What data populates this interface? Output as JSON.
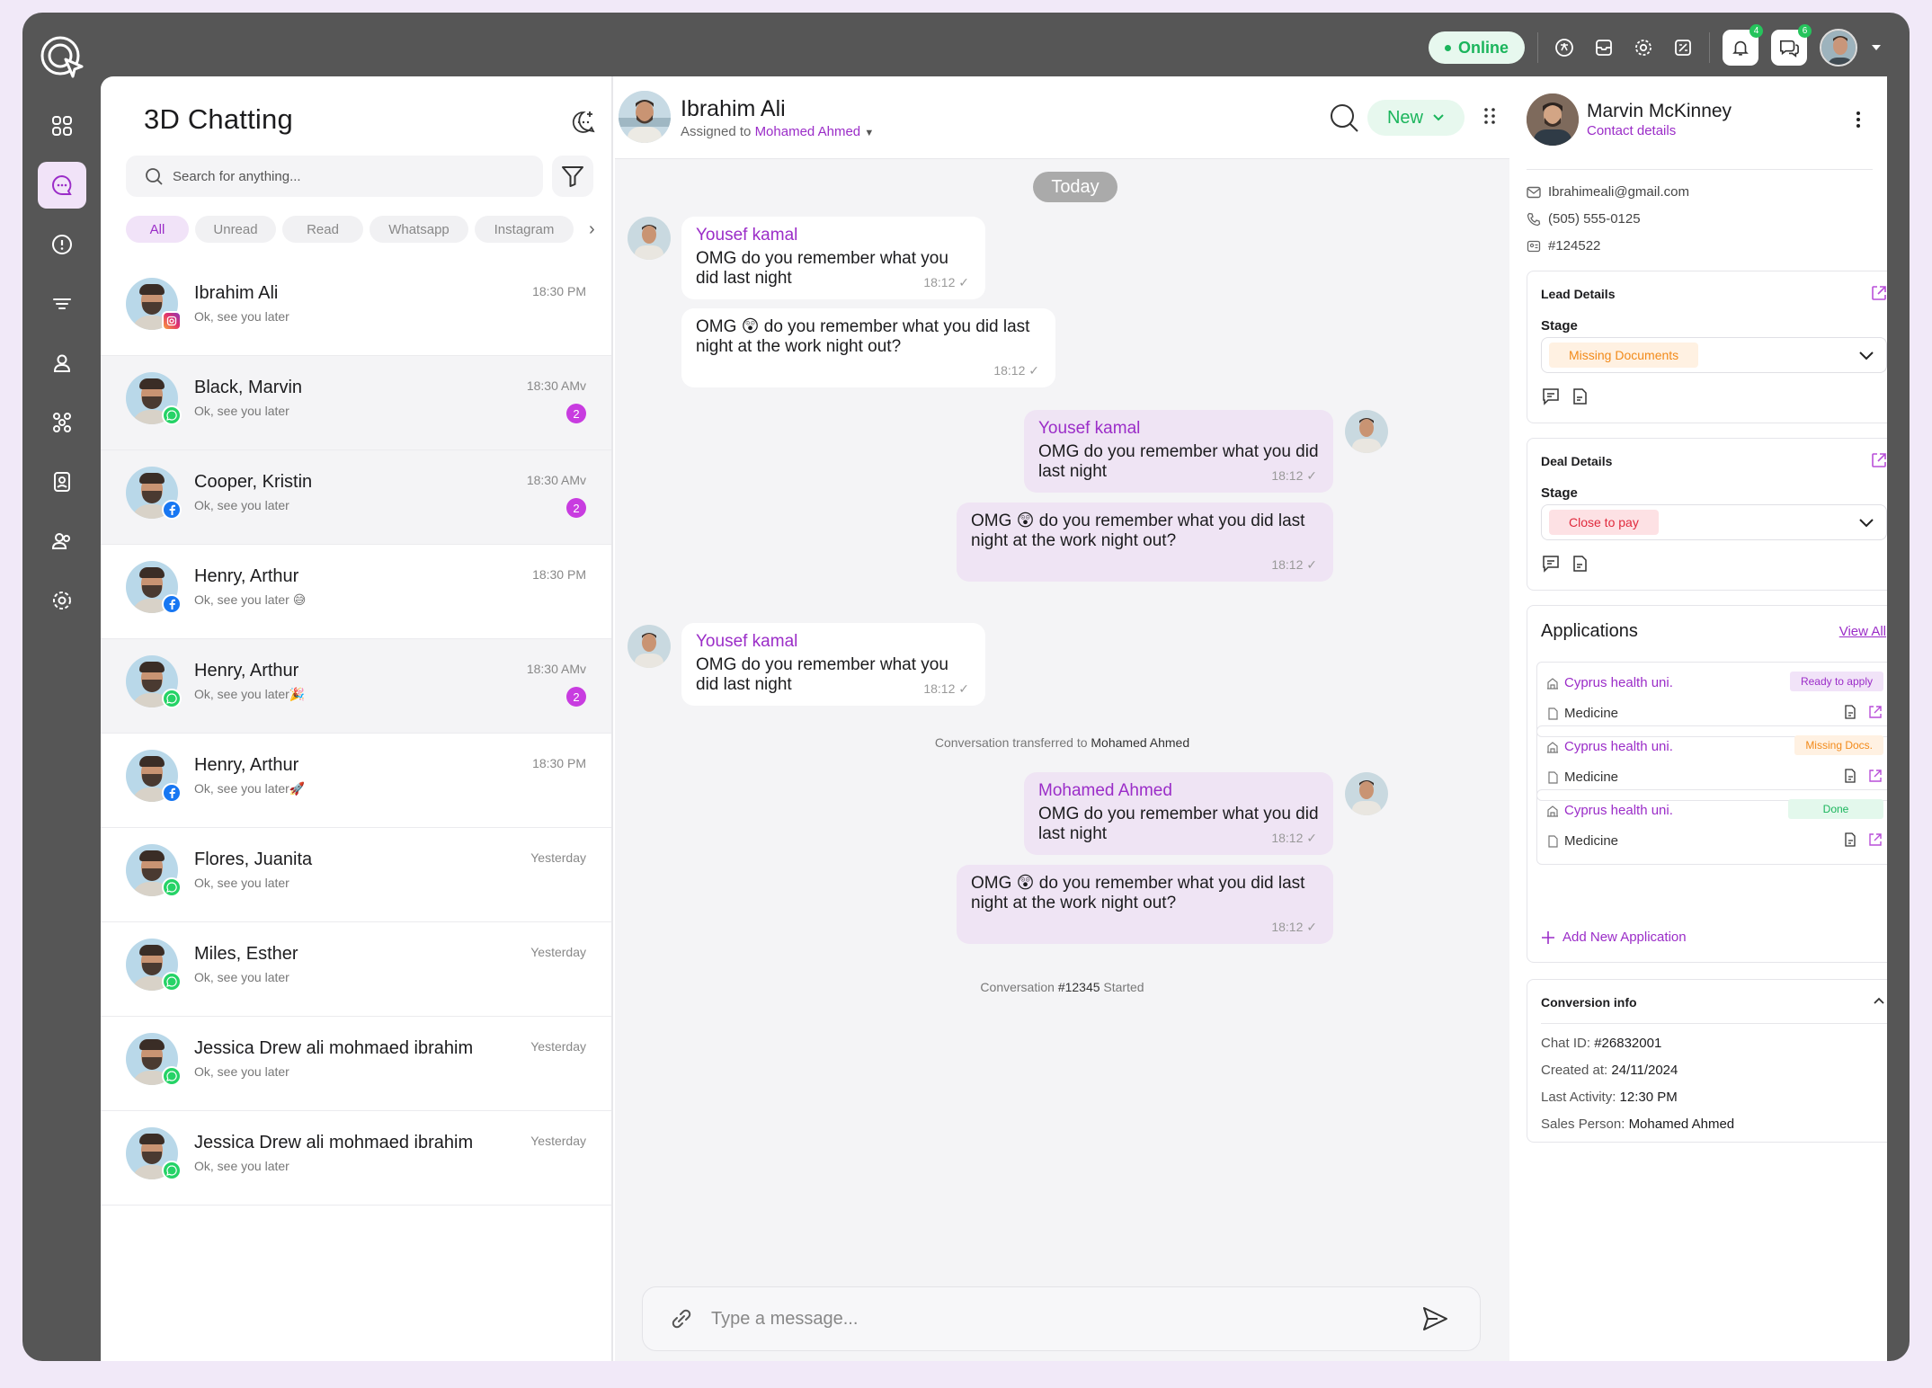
{
  "topbar": {
    "status": "Online",
    "notifications_count": "4",
    "messages_count": "6"
  },
  "sidenav": {
    "items": [
      "dashboard",
      "chat",
      "alerts",
      "filters",
      "contacts",
      "workflows",
      "reports",
      "team",
      "settings"
    ]
  },
  "list": {
    "title": "3D Chatting",
    "search_placeholder": "Search for anything...",
    "filters": [
      "All",
      "Unread",
      "Read",
      "Whatsapp",
      "Instagram"
    ],
    "conversations": [
      {
        "name": "Ibrahim Ali",
        "message": "Ok, see you later",
        "time": "18:30 PM",
        "channel": "instagram",
        "badge": ""
      },
      {
        "name": "Black, Marvin",
        "message": "Ok, see you later",
        "time": "18:30 AMv",
        "channel": "whatsapp",
        "badge": "2"
      },
      {
        "name": "Cooper, Kristin",
        "message": "Ok, see you later",
        "time": "18:30 AMv",
        "channel": "facebook",
        "badge": "2"
      },
      {
        "name": "Henry, Arthur",
        "message": "Ok, see you later 😅",
        "time": "18:30 PM",
        "channel": "facebook",
        "badge": ""
      },
      {
        "name": "Henry, Arthur",
        "message": "Ok, see you later🎉",
        "time": "18:30 AMv",
        "channel": "whatsapp",
        "badge": "2"
      },
      {
        "name": "Henry, Arthur",
        "message": "Ok, see you later🚀",
        "time": "18:30 PM",
        "channel": "facebook",
        "badge": ""
      },
      {
        "name": "Flores, Juanita",
        "message": "Ok, see you later",
        "time": "Yesterday",
        "channel": "whatsapp",
        "badge": ""
      },
      {
        "name": "Miles, Esther",
        "message": "Ok, see you later",
        "time": "Yesterday",
        "channel": "whatsapp",
        "badge": ""
      },
      {
        "name": "Jessica Drew ali mohmaed ibrahim",
        "message": "Ok, see you later",
        "time": "Yesterday",
        "channel": "whatsapp",
        "badge": ""
      },
      {
        "name": "Jessica Drew ali mohmaed ibrahim",
        "message": "Ok, see you later",
        "time": "Yesterday",
        "channel": "whatsapp",
        "badge": ""
      }
    ]
  },
  "chat": {
    "contact_name": "Ibrahim Ali",
    "assigned_prefix": "Assigned to",
    "assigned_to": "Mohamed Ahmed",
    "status_button": "New",
    "day_label": "Today",
    "messages": [
      {
        "sender": "Yousef kamal",
        "text": "OMG  do you remember what you did last night",
        "time": "18:12 ✓"
      },
      {
        "sender": "",
        "text": "OMG 😲 do you remember what you did last night at the work night out?",
        "time": "18:12 ✓"
      },
      {
        "sender": "Yousef kamal",
        "text": "OMG  do you remember what you did last night",
        "time": "18:12 ✓"
      },
      {
        "sender": "",
        "text": "OMG 😲 do you remember what you did last night at the work night out?",
        "time": "18:12 ✓"
      },
      {
        "sender": "Yousef kamal",
        "text": "OMG  do you remember what you did last night",
        "time": "18:12 ✓"
      },
      {
        "sender": "Mohamed Ahmed",
        "text": "OMG  do you remember what you did last night",
        "time": "18:12 ✓"
      },
      {
        "sender": "",
        "text": "OMG 😲 do you remember what you did last night at the work night out?",
        "time": "18:12 ✓"
      }
    ],
    "transfer_prefix": "Conversation transferred to",
    "transfer_to": "Mohamed Ahmed",
    "started_prefix": "Conversation",
    "started_id": "#12345",
    "started_suffix": "Started",
    "composer_placeholder": "Type a message..."
  },
  "contact": {
    "name": "Marvin McKinney",
    "subtitle": "Contact details",
    "email": "Ibrahimeali@gmail.com",
    "phone": "(505) 555-0125",
    "id": "#124522",
    "lead": {
      "title": "Lead Details",
      "stage_label": "Stage",
      "stage_value": "Missing Documents"
    },
    "deal": {
      "title": "Deal Details",
      "stage_label": "Stage",
      "stage_value": "Close to pay"
    },
    "applications": {
      "title": "Applications",
      "view_all": "View All",
      "items": [
        {
          "university": "Cyprus health uni.",
          "program": "Medicine",
          "status": "Ready to apply"
        },
        {
          "university": "Cyprus health uni.",
          "program": "Medicine",
          "status": "Missing Docs."
        },
        {
          "university": "Cyprus health uni.",
          "program": "Medicine",
          "status": "Done"
        }
      ],
      "add_label": "Add New Application"
    },
    "conversion": {
      "title": "Conversion info",
      "chat_id_label": "Chat ID:",
      "chat_id": "#26832001",
      "created_label": "Created at:",
      "created": "24/11/2024",
      "last_activity_label": "Last Activity:",
      "last_activity": "12:30 PM",
      "sales_label": "Sales Person:",
      "sales": "Mohamed Ahmed"
    }
  },
  "colors": {
    "accent": "#9b2dc8",
    "online": "#1bb55c",
    "chrome": "#565656"
  }
}
